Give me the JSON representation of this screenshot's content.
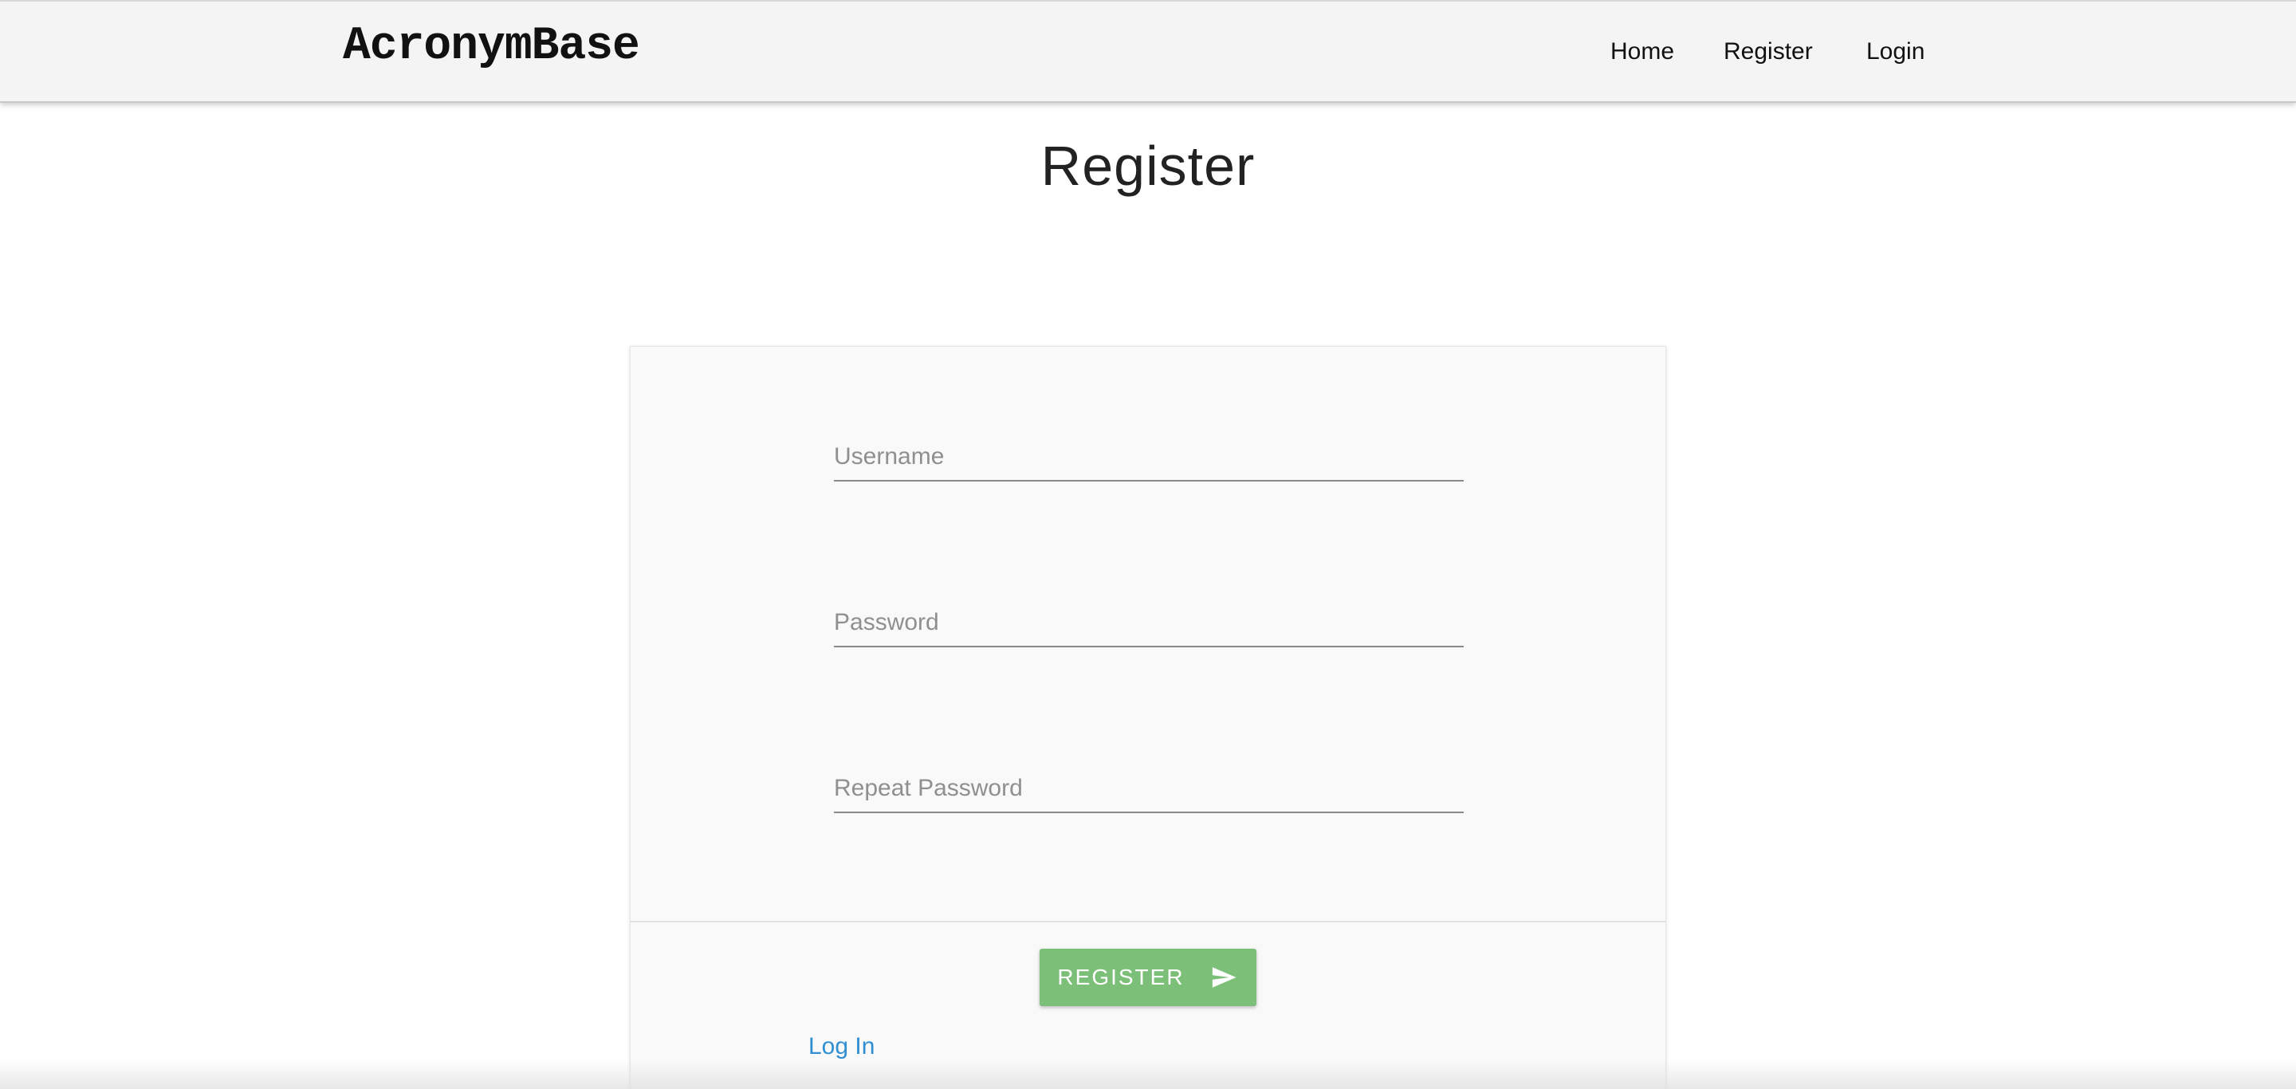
{
  "navbar": {
    "brand": "AcronymBase",
    "links": {
      "home": "Home",
      "register": "Register",
      "login": "Login"
    }
  },
  "main": {
    "title": "Register"
  },
  "form": {
    "username_placeholder": "Username",
    "password_placeholder": "Password",
    "repeat_password_placeholder": "Repeat Password",
    "submit_label": "REGISTER",
    "submit_icon": "send-icon",
    "login_link": "Log In"
  },
  "colors": {
    "navbar_bg": "#f4f4f4",
    "button_green": "#7cbf78",
    "link_blue": "#2f8fd0"
  }
}
